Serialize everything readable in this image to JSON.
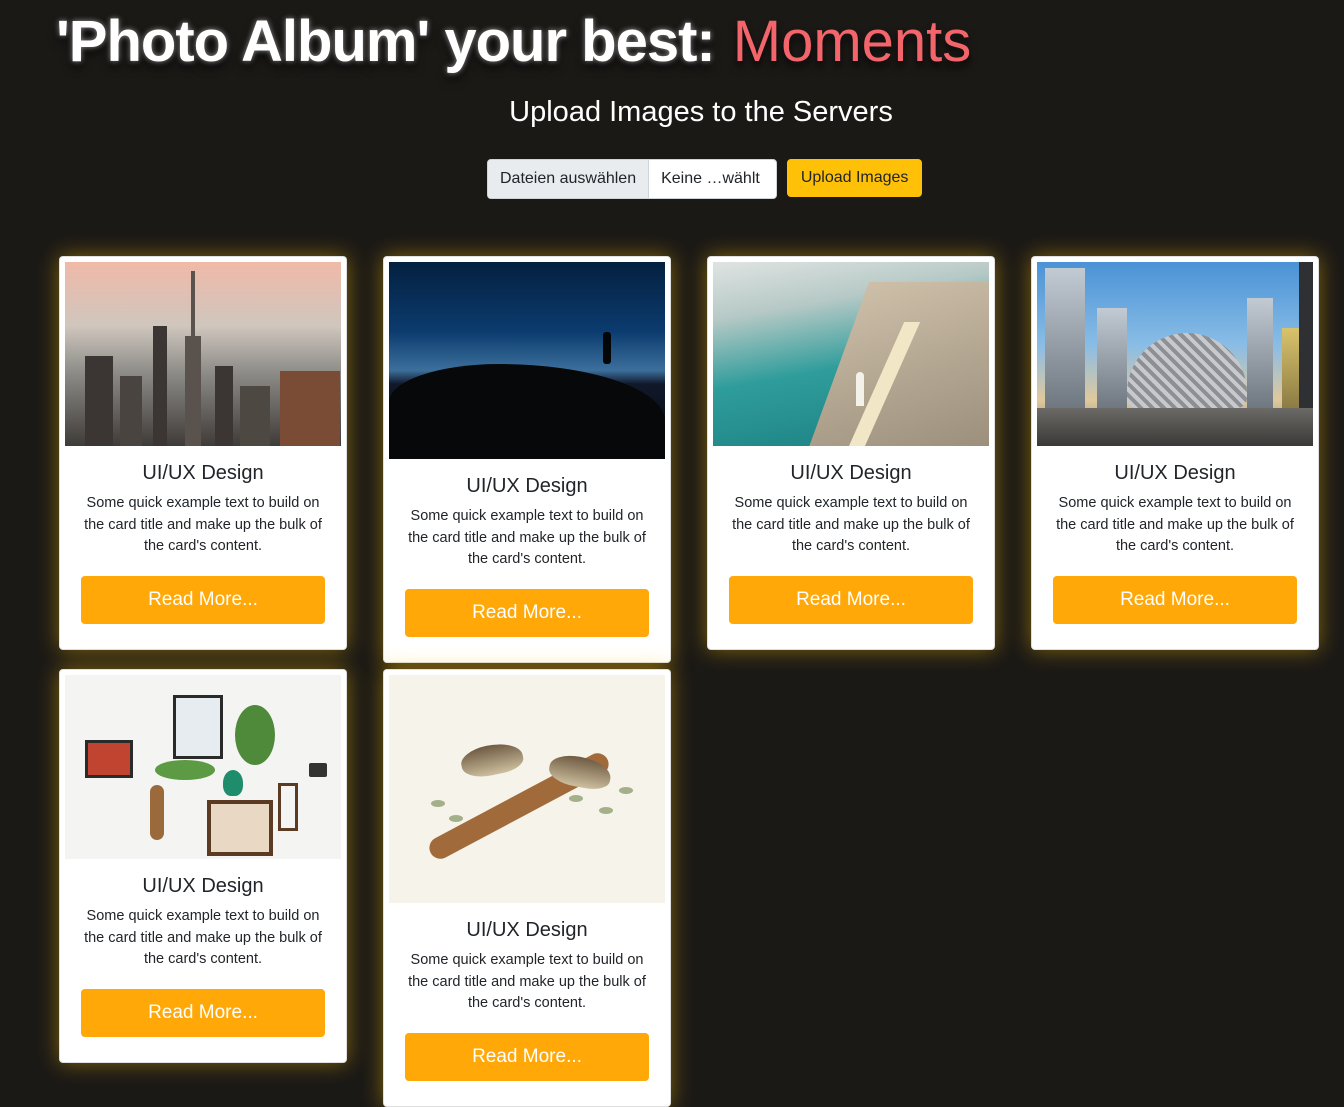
{
  "hero": {
    "title_prefix": "'Photo Album' your best:",
    "title_accent": "Moments",
    "subtitle": "Upload Images to the Servers"
  },
  "upload": {
    "choose_label": "Dateien auswählen",
    "status_text": "Keine …wählt",
    "button_label": "Upload Images"
  },
  "colors": {
    "background": "#1b1916",
    "accent_title": "#f3656b",
    "upload_button": "#ffc107",
    "read_more_button": "#ffa808",
    "card_glow": "#ffc107"
  },
  "cards": [
    {
      "image": "city-skyline-sunset-photo",
      "title": "UI/UX Design",
      "text": "Some quick example text to build on the card title and make up the bulk of the card's content.",
      "button": "Read More..."
    },
    {
      "image": "night-hilltop-silhouette-photo",
      "title": "UI/UX Design",
      "text": "Some quick example text to build on the card title and make up the bulk of the card's content.",
      "button": "Read More..."
    },
    {
      "image": "aerial-beach-coastline-photo",
      "title": "UI/UX Design",
      "text": "Some quick example text to build on the card title and make up the bulk of the card's content.",
      "button": "Read More..."
    },
    {
      "image": "dubai-street-towers-photo",
      "title": "UI/UX Design",
      "text": "Some quick example text to build on the card title and make up the bulk of the card's content.",
      "button": "Read More..."
    },
    {
      "image": "wall-decor-plants-photo",
      "title": "UI/UX Design",
      "text": "Some quick example text to build on the card title and make up the bulk of the card's content.",
      "button": "Read More..."
    },
    {
      "image": "birds-on-branch-illustration",
      "title": "UI/UX Design",
      "text": "Some quick example text to build on the card title and make up the bulk of the card's content.",
      "button": "Read More..."
    }
  ]
}
